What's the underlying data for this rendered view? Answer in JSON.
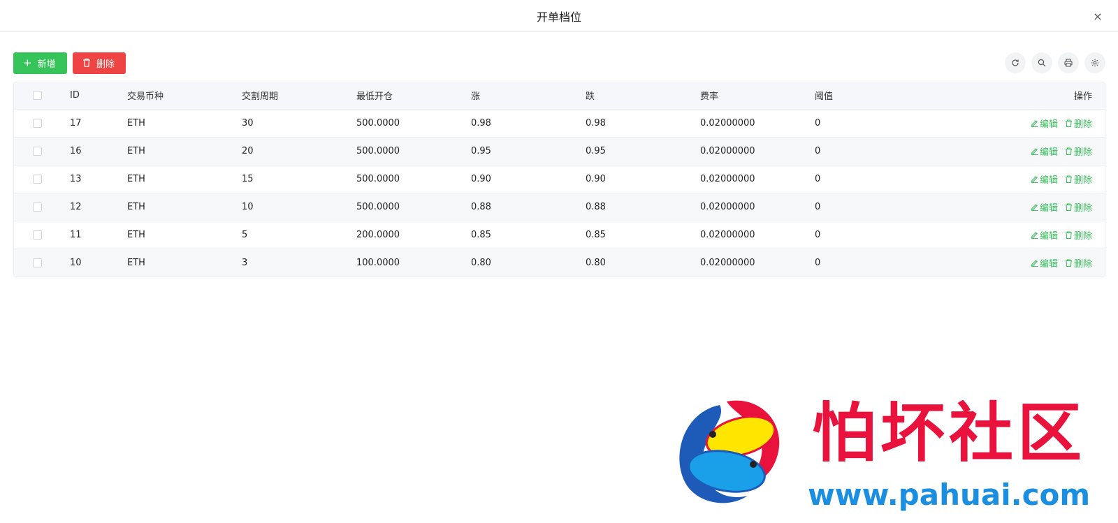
{
  "dialog": {
    "title": "开单档位",
    "close_label": "×"
  },
  "toolbar": {
    "add_label": "新增",
    "delete_label": "删除"
  },
  "tools": [
    "refresh-icon",
    "search-icon",
    "print-icon",
    "settings-icon"
  ],
  "table": {
    "headers": [
      "ID",
      "交易币种",
      "交割周期",
      "最低开仓",
      "涨",
      "跌",
      "费率",
      "阈值",
      "操作"
    ],
    "rows": [
      {
        "id": "17",
        "coin": "ETH",
        "period": "30",
        "min_open": "500.0000",
        "up": "0.98",
        "down": "0.98",
        "fee": "0.02000000",
        "threshold": "0"
      },
      {
        "id": "16",
        "coin": "ETH",
        "period": "20",
        "min_open": "500.0000",
        "up": "0.95",
        "down": "0.95",
        "fee": "0.02000000",
        "threshold": "0"
      },
      {
        "id": "13",
        "coin": "ETH",
        "period": "15",
        "min_open": "500.0000",
        "up": "0.90",
        "down": "0.90",
        "fee": "0.02000000",
        "threshold": "0"
      },
      {
        "id": "12",
        "coin": "ETH",
        "period": "10",
        "min_open": "500.0000",
        "up": "0.88",
        "down": "0.88",
        "fee": "0.02000000",
        "threshold": "0"
      },
      {
        "id": "11",
        "coin": "ETH",
        "period": "5",
        "min_open": "200.0000",
        "up": "0.85",
        "down": "0.85",
        "fee": "0.02000000",
        "threshold": "0"
      },
      {
        "id": "10",
        "coin": "ETH",
        "period": "3",
        "min_open": "100.0000",
        "up": "0.80",
        "down": "0.80",
        "fee": "0.02000000",
        "threshold": "0"
      }
    ],
    "ops": {
      "edit_label": "编辑",
      "delete_label": "删除"
    }
  },
  "watermark": {
    "name": "怕坏社区",
    "url": "www.pahuai.com"
  },
  "colors": {
    "accent_green": "#36c45a",
    "danger_red": "#ee4444"
  }
}
